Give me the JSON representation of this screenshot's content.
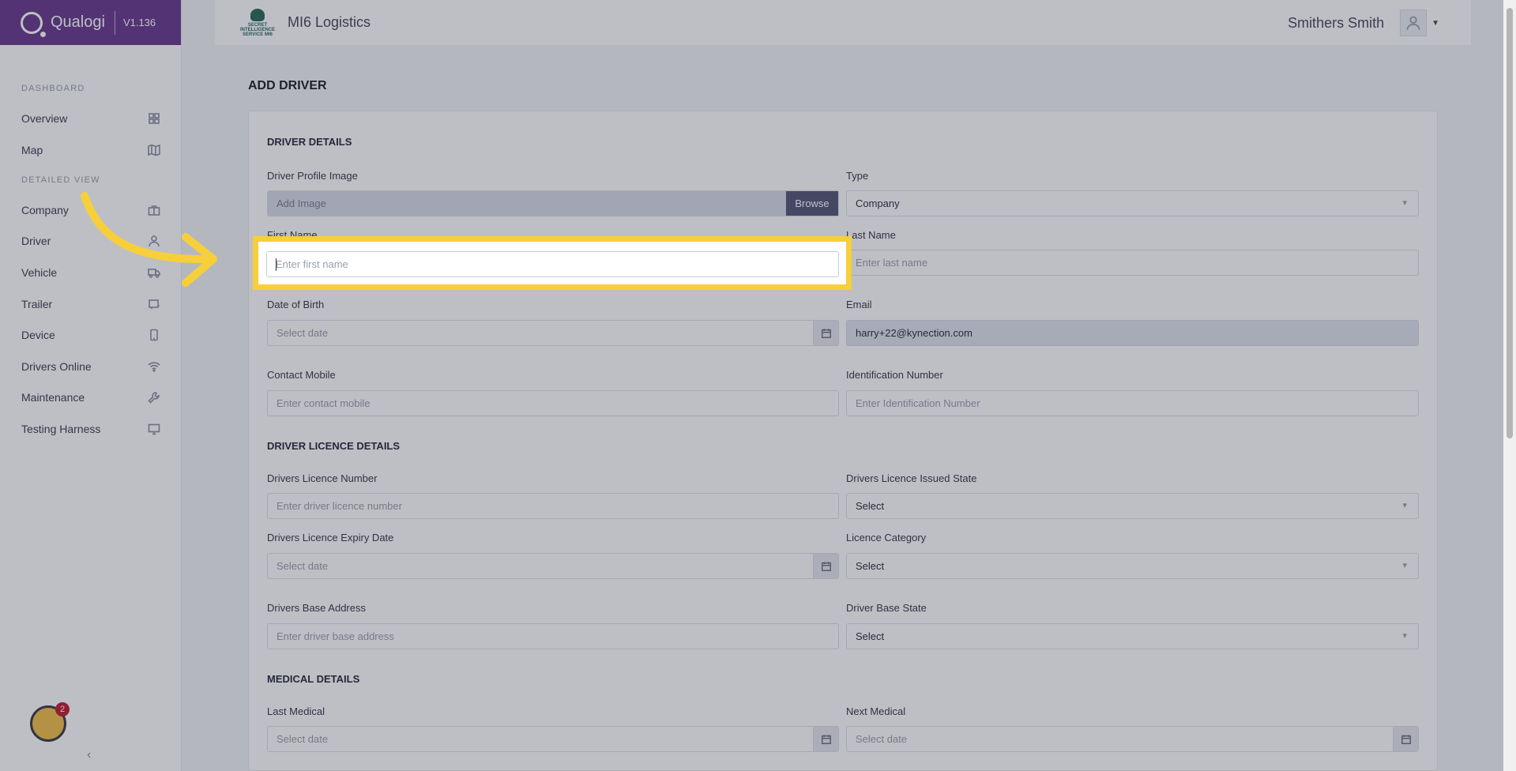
{
  "brand": {
    "name": "Qualogi",
    "version": "V1.136"
  },
  "sidebar": {
    "sections": [
      {
        "title": "DASHBOARD",
        "items": [
          {
            "label": "Overview",
            "icon": "grid-icon"
          },
          {
            "label": "Map",
            "icon": "map-icon"
          }
        ]
      },
      {
        "title": "DETAILED VIEW",
        "items": [
          {
            "label": "Company",
            "icon": "briefcase-icon"
          },
          {
            "label": "Driver",
            "icon": "user-icon"
          },
          {
            "label": "Vehicle",
            "icon": "truck-icon"
          },
          {
            "label": "Trailer",
            "icon": "trailer-icon"
          },
          {
            "label": "Device",
            "icon": "phone-icon"
          },
          {
            "label": "Drivers Online",
            "icon": "wifi-icon"
          },
          {
            "label": "Maintenance",
            "icon": "wrench-icon"
          },
          {
            "label": "Testing Harness",
            "icon": "monitor-icon"
          }
        ]
      }
    ],
    "notification_count": "2",
    "collapse_label": "‹"
  },
  "topbar": {
    "company_logo_text": "SECRET INTELLIGENCE SERVICE MI6",
    "company_name": "MI6 Logistics",
    "user_name": "Smithers Smith"
  },
  "page": {
    "title": "ADD DRIVER"
  },
  "driver_details": {
    "title": "DRIVER DETAILS",
    "profile_image_label": "Driver Profile Image",
    "profile_image_placeholder": "Add Image",
    "browse_label": "Browse",
    "type_label": "Type",
    "type_value": "Company",
    "first_name_label": "First Name",
    "first_name_placeholder": "Enter first name",
    "last_name_label": "Last Name",
    "last_name_placeholder": "Enter last name",
    "dob_label": "Date of Birth",
    "dob_placeholder": "Select date",
    "email_label": "Email",
    "email_value": "harry+22@kynection.com",
    "mobile_label": "Contact Mobile",
    "mobile_placeholder": "Enter contact mobile",
    "id_label": "Identification Number",
    "id_placeholder": "Enter Identification Number"
  },
  "licence_details": {
    "title": "DRIVER LICENCE DETAILS",
    "number_label": "Drivers Licence Number",
    "number_placeholder": "Enter driver licence number",
    "issued_state_label": "Drivers Licence Issued State",
    "issued_state_value": "Select",
    "expiry_label": "Drivers Licence Expiry Date",
    "expiry_placeholder": "Select date",
    "category_label": "Licence Category",
    "category_value": "Select",
    "base_address_label": "Drivers Base Address",
    "base_address_placeholder": "Enter driver base address",
    "base_state_label": "Driver Base State",
    "base_state_value": "Select"
  },
  "medical_details": {
    "title": "MEDICAL DETAILS",
    "last_label": "Last Medical",
    "last_placeholder": "Select date",
    "next_label": "Next Medical",
    "next_placeholder": "Select date"
  },
  "colors": {
    "brand": "#6b3d8f",
    "highlight": "#f7cf3a",
    "browse": "#575a7a"
  }
}
